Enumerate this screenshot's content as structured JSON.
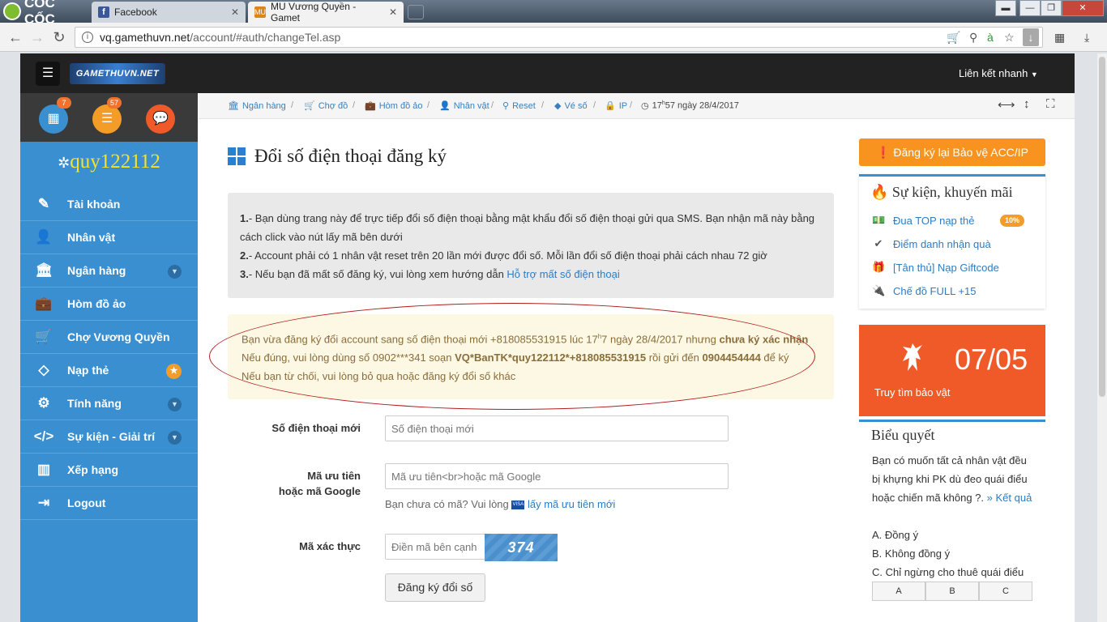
{
  "browser": {
    "brand": "CỐC CỐC",
    "tabs": [
      {
        "label": "Facebook",
        "favicon": "f"
      },
      {
        "label": "MU Vương Quyền - Gamet",
        "favicon": "MU"
      }
    ],
    "url_host": "vq.gamethuvn.net",
    "url_path": "/account/#auth/changeTel.asp"
  },
  "header": {
    "logo_text": "GAMETHUVN.NET",
    "quick_link": "Liên kết nhanh"
  },
  "icon_row": {
    "badges": [
      "7",
      "57"
    ]
  },
  "sidebar": {
    "username": "quy122112",
    "items": [
      {
        "label": "Tài khoản",
        "icon": "edit-icon"
      },
      {
        "label": "Nhân vật",
        "icon": "user-icon"
      },
      {
        "label": "Ngân hàng",
        "icon": "bank-icon"
      },
      {
        "label": "Hòm đồ ảo",
        "icon": "briefcase-icon"
      },
      {
        "label": "Chợ Vương Quyền",
        "icon": "cart-icon"
      },
      {
        "label": "Nạp thẻ",
        "icon": "diamond-icon"
      },
      {
        "label": "Tính năng",
        "icon": "gears-icon"
      },
      {
        "label": "Sự kiện - Giải trí",
        "icon": "code-icon"
      },
      {
        "label": "Xếp hạng",
        "icon": "bar-chart-icon"
      },
      {
        "label": "Logout",
        "icon": "sign-out-icon"
      }
    ]
  },
  "breadcrumb": {
    "items": [
      "Ngân hàng",
      "Chợ đồ",
      "Hòm đồ ảo",
      "Nhân vật",
      "Reset",
      "Vé số",
      "IP"
    ],
    "time_hour": "17",
    "time_sup": "h",
    "time_rest": "57 ngày 28/4/2017"
  },
  "main": {
    "title": "Đổi số điện thoại đăng ký",
    "info": {
      "l1_num": "1.",
      "l1": "- Bạn dùng trang này để trực tiếp đổi số điện thoại bằng mật khẩu đổi số điện thoại gửi qua SMS. Bạn nhận mã này bằng",
      "l1b": "cách click vào nút lấy mã bên dưới",
      "l2_num": "2.",
      "l2": "- Account phải có 1 nhân vật reset trên 20 lần mới được đổi số. Mỗi lần đổi số điện thoại phải cách nhau 72 giờ",
      "l3_num": "3.",
      "l3": "- Nếu bạn đã mất số đăng ký, vui lòng xem hướng dẫn ",
      "l3_link": "Hỗ trợ mất số điện thoại"
    },
    "warning": {
      "w1a": "Bạn vừa đăng ký đổi account sang số điện thoại mới +818085531915 lúc 17",
      "w1sup": "h",
      "w1b": "7 ngày 28/4/2017 nhưng ",
      "w1bold": "chưa ký xác nhận",
      "w2a": "Nếu đúng, vui lòng dùng số 0902***341 soạn ",
      "w2bold": "VQ*BanTK*quy122112*+818085531915",
      "w2b": " rồi gửi đến ",
      "w2bold2": "0904454444",
      "w2c": " để ký",
      "w3": "Nếu bạn từ chối, vui lòng bỏ qua hoặc đăng ký đổi số khác"
    },
    "form": {
      "phone_label": "Số điện thoại mới",
      "phone_placeholder": "Số điện thoại mới",
      "code_label_1": "Mã ưu tiên",
      "code_label_2": "hoặc mã Google",
      "code_placeholder": "Mã ưu tiên<br>hoặc mã Google",
      "help_text": "Bạn chưa có mã? Vui lòng ",
      "help_link": "lấy mã ưu tiên mới",
      "captcha_label": "Mã xác thực",
      "captcha_placeholder": "Điền mã bên cạnh",
      "captcha_value": "374",
      "submit": "Đăng ký đổi số"
    }
  },
  "right": {
    "register_button": "Đăng ký lại Bảo vệ ACC/IP",
    "events_title": "Sự kiện, khuyến mãi",
    "events": [
      {
        "label": "Đua TOP nạp thẻ",
        "icon": "money-icon"
      },
      {
        "label": "Điểm danh nhận quà",
        "icon": "check-circle-icon"
      },
      {
        "label": "[Tân thủ] Nạp Giftcode",
        "icon": "gift-icon"
      },
      {
        "label": "Chế đồ FULL +15",
        "icon": "plug-icon"
      }
    ],
    "percent_badge": "10%",
    "promo_date": "07/05",
    "promo_label": "Truy tìm bảo vật",
    "poll_title": "Biểu quyết",
    "poll_q1": "Bạn có muốn tất cả nhân vật đều",
    "poll_q2": "bị khựng khi PK dù đeo quái điểu",
    "poll_q3": "hoặc chiến mã không ?. ",
    "poll_result": "» Kết quả",
    "poll_options": [
      "A. Đồng ý",
      "B. Không đồng ý",
      "C. Chỉ ngừng cho thuê quái điểu"
    ],
    "poll_buttons": [
      "A",
      "B",
      "C"
    ]
  },
  "colors": {
    "sidebar": "#3a8fd0",
    "accent_orange": "#f7931e",
    "promo": "#f05a28",
    "username": "#f6e12b"
  }
}
